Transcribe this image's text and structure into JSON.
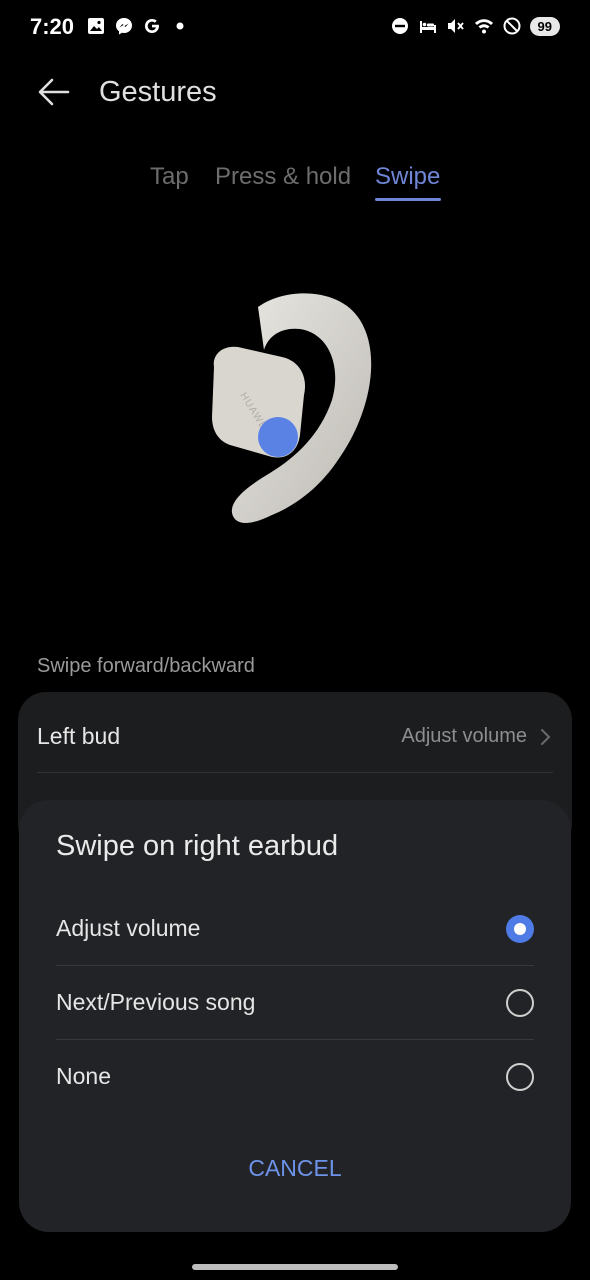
{
  "status_bar": {
    "time": "7:20",
    "battery": "99",
    "left_icons": [
      "gallery-icon",
      "messenger-icon",
      "google-icon",
      "dot-icon"
    ],
    "right_icons": [
      "dnd-icon",
      "bed-icon",
      "mute-icon",
      "wifi-icon",
      "block-icon"
    ]
  },
  "app_bar": {
    "title": "Gestures"
  },
  "tabs": [
    {
      "label": "Tap",
      "active": false
    },
    {
      "label": "Press & hold",
      "active": false
    },
    {
      "label": "Swipe",
      "active": true
    }
  ],
  "earbud": {
    "brand": "HUAWEI"
  },
  "section": {
    "label": "Swipe forward/backward"
  },
  "settings": [
    {
      "label": "Left bud",
      "value": "Adjust volume"
    }
  ],
  "dialog": {
    "title": "Swipe on right earbud",
    "options": [
      {
        "label": "Adjust volume",
        "selected": true
      },
      {
        "label": "Next/Previous song",
        "selected": false
      },
      {
        "label": "None",
        "selected": false
      }
    ],
    "cancel_label": "CANCEL"
  },
  "colors": {
    "accent": "#6f86d6",
    "radio_selected": "#4f7be6",
    "dialog_bg": "#222326",
    "card_bg": "#1c1d1f"
  }
}
